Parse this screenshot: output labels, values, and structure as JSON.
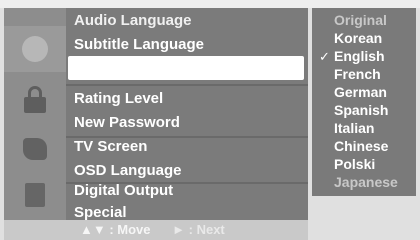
{
  "menu": {
    "items": [
      {
        "label": "Audio Language"
      },
      {
        "label": "Subtitle Language"
      },
      {
        "label": ""
      },
      {
        "label": "Rating Level"
      },
      {
        "label": "New Password"
      },
      {
        "label": "TV Screen"
      },
      {
        "label": "OSD Language"
      },
      {
        "label": "Digital Output"
      },
      {
        "label": "Special"
      }
    ],
    "selected_label": "Subtitle Language"
  },
  "submenu": {
    "items": [
      {
        "label": "Original"
      },
      {
        "label": "Korean"
      },
      {
        "label": "English",
        "checked": true
      },
      {
        "label": "French"
      },
      {
        "label": "German"
      },
      {
        "label": "Spanish"
      },
      {
        "label": "Italian"
      },
      {
        "label": "Chinese"
      },
      {
        "label": "Polski"
      },
      {
        "label": "Japanese"
      }
    ],
    "check_mark": "✓"
  },
  "help": {
    "move": "▲▼ : Move",
    "next": "► : Next"
  },
  "icons": [
    "disc-icon",
    "lock-icon",
    "screen-icon",
    "book-icon"
  ],
  "colors": {
    "menu_bg": "#7b7b7b",
    "selection": "#ffffff",
    "text": "#ffffff"
  }
}
